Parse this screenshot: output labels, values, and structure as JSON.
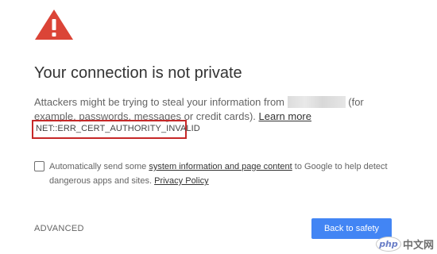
{
  "icons": {
    "warning": "warning-icon"
  },
  "colors": {
    "warning_red": "#db4437",
    "error_box_border": "#c62828",
    "primary_button": "#4285f4"
  },
  "heading": {
    "title": "Your connection is not private"
  },
  "explanation": {
    "text_before_host": "Attackers might be trying to steal your information from",
    "text_after_host": "(for example, passwords, messages or credit cards).",
    "learn_more_label": "Learn more"
  },
  "error": {
    "code": "NET::ERR_CERT_AUTHORITY_INVALID"
  },
  "report": {
    "checked": false,
    "text_before_link": "Automatically send some",
    "system_info_link": "system information and page content",
    "text_after_link": "to Google to help detect dangerous apps and sites.",
    "privacy_policy_link": "Privacy Policy"
  },
  "actions": {
    "advanced_label": "ADVANCED",
    "back_to_safety_label": "Back to safety"
  },
  "watermark": {
    "logo_text": "php",
    "site_text": "中文网"
  }
}
